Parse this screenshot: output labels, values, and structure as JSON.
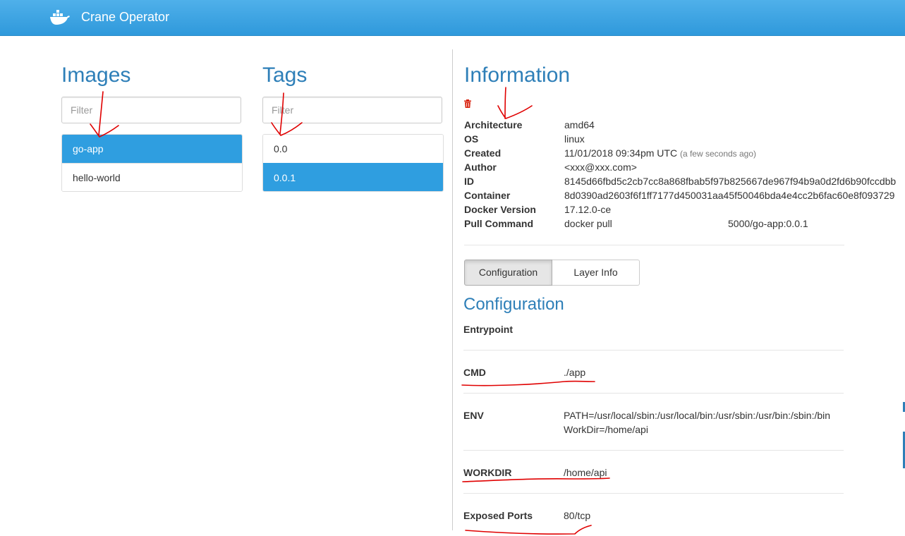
{
  "app": {
    "title": "Crane Operator"
  },
  "images": {
    "title": "Images",
    "filter_placeholder": "Filter",
    "items": [
      "go-app",
      "hello-world"
    ]
  },
  "tags": {
    "title": "Tags",
    "filter_placeholder": "Filter",
    "items": [
      "0.0",
      "0.0.1"
    ]
  },
  "information": {
    "title": "Information",
    "rows": [
      {
        "key": "Architecture",
        "value": "amd64"
      },
      {
        "key": "OS",
        "value": "linux"
      },
      {
        "key": "Created",
        "value": "11/01/2018 09:34pm UTC",
        "note": "(a few seconds ago)"
      },
      {
        "key": "Author",
        "value": "<xxx@xxx.com>"
      },
      {
        "key": "ID",
        "value": "8145d66fbd5c2cb7cc8a868fbab5f97b825667de967f94b9a0d2fd6b90fccdbb"
      },
      {
        "key": "Container",
        "value": "8d0390ad2603f6f1ff7177d450031aa45f50046bda4e4cc2b6fac60e8f093729"
      },
      {
        "key": "Docker Version",
        "value": "17.12.0-ce"
      },
      {
        "key": "Pull Command",
        "value": "docker pull",
        "value2": "5000/go-app:0.0.1"
      }
    ]
  },
  "tabs": [
    "Configuration",
    "Layer Info"
  ],
  "configuration": {
    "title": "Configuration",
    "rows": [
      {
        "key": "Entrypoint",
        "value": ""
      },
      {
        "key": "CMD",
        "value": "./app"
      },
      {
        "key": "ENV",
        "value": "PATH=/usr/local/sbin:/usr/local/bin:/usr/sbin:/usr/bin:/sbin:/bin",
        "value2": "WorkDir=/home/api"
      },
      {
        "key": "WORKDIR",
        "value": "/home/api"
      },
      {
        "key": "Exposed Ports",
        "value": "80/tcp"
      }
    ]
  },
  "colors": {
    "navbar": "#2f99db",
    "active": "#2f9ee0",
    "heading": "#2e7fb8",
    "annotation": "#e00000"
  }
}
